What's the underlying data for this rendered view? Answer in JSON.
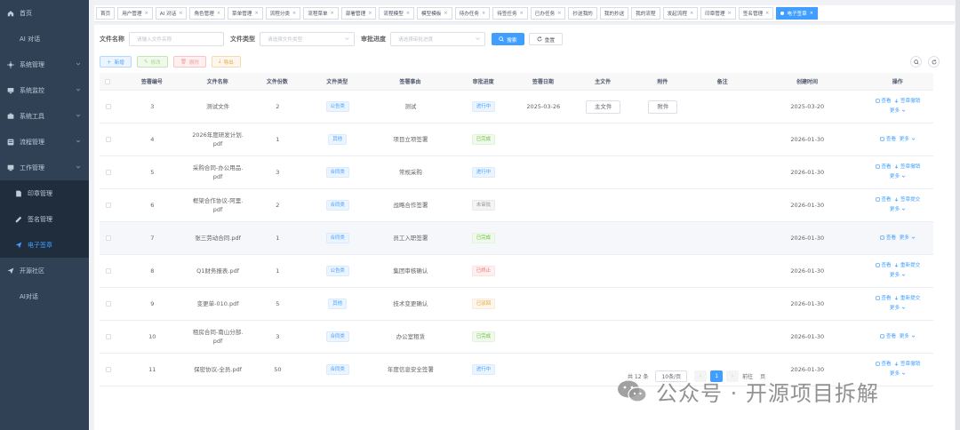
{
  "sidebar": {
    "items": [
      {
        "label": "首页",
        "icon": "home-icon",
        "type": "top"
      },
      {
        "label": "AI 对话",
        "type": "plain"
      },
      {
        "label": "系统管理",
        "icon": "gear-icon",
        "type": "group"
      },
      {
        "label": "系统监控",
        "icon": "monitor-icon",
        "type": "group"
      },
      {
        "label": "系统工具",
        "icon": "tool-icon",
        "type": "group"
      },
      {
        "label": "流程管理",
        "icon": "flow-icon",
        "type": "group"
      },
      {
        "label": "工作管理",
        "icon": "work-icon",
        "type": "group-open"
      }
    ],
    "submenu": [
      {
        "label": "印章管理",
        "icon": "document-icon"
      },
      {
        "label": "签名管理",
        "icon": "signature-icon"
      },
      {
        "label": "电子签章",
        "icon": "send-icon",
        "active": true
      }
    ],
    "bottom": [
      {
        "label": "开源社区",
        "icon": "send-icon",
        "type": "top"
      },
      {
        "label": "AI对话",
        "type": "plain"
      }
    ]
  },
  "tags": [
    {
      "label": "首页",
      "closable": false
    },
    {
      "label": "用户管理",
      "closable": true
    },
    {
      "label": "AI 对话",
      "closable": true
    },
    {
      "label": "角色管理",
      "closable": true
    },
    {
      "label": "菜单管理",
      "closable": true
    },
    {
      "label": "流程分类",
      "closable": true
    },
    {
      "label": "流程菜单",
      "closable": true
    },
    {
      "label": "部署管理",
      "closable": true
    },
    {
      "label": "流程模型",
      "closable": true
    },
    {
      "label": "模型模板",
      "closable": true
    },
    {
      "label": "待办任务",
      "closable": true
    },
    {
      "label": "待签任务",
      "closable": true
    },
    {
      "label": "已办任务",
      "closable": true
    },
    {
      "label": "抄送我的",
      "closable": false
    },
    {
      "label": "我的抄送",
      "closable": false
    },
    {
      "label": "我的流程",
      "closable": false
    },
    {
      "label": "发起流程",
      "closable": true
    },
    {
      "label": "印章管理",
      "closable": true
    },
    {
      "label": "签名管理",
      "closable": true
    },
    {
      "label": "电子签章",
      "closable": true,
      "active": true
    }
  ],
  "search": {
    "file_name_label": "文件名称",
    "file_name_placeholder": "请输入文件名称",
    "file_type_label": "文件类型",
    "file_type_placeholder": "请选择文件类型",
    "progress_label": "审批进度",
    "progress_placeholder": "请选择审批进度",
    "search_button": "搜索",
    "reset_button": "重置"
  },
  "toolbar": {
    "add": "新增",
    "edit": "修改",
    "delete": "删除",
    "export": "导出"
  },
  "table": {
    "columns": [
      "签署编号",
      "文件名称",
      "文件份数",
      "文件类型",
      "签署事由",
      "审批进度",
      "签署日期",
      "主文件",
      "附件",
      "备注",
      "创建时间",
      "操作"
    ],
    "rows": [
      {
        "id": "3",
        "name": "测试文件",
        "copies": "2",
        "type": "公告类",
        "type_color": "blue",
        "reason": "测试",
        "status": "进行中",
        "status_color": "blue",
        "sign_date": "2025-03-26",
        "main_file": "主文件",
        "attachment": "附件",
        "created": "2025-03-20",
        "op1": "查看",
        "op2": "签章撤销",
        "more": "更多",
        "two_line": true
      },
      {
        "id": "4",
        "name": "2026年度研发计划.pdf",
        "copies": "1",
        "type": "其他",
        "type_color": "blue",
        "reason": "项目立项签署",
        "status": "已完成",
        "status_color": "green",
        "sign_date": "",
        "main_file": "",
        "attachment": "",
        "created": "2026-01-30",
        "op1": "查看",
        "op2": "",
        "more": "更多",
        "two_line": false
      },
      {
        "id": "5",
        "name": "采购合同-办公用品.pdf",
        "copies": "3",
        "type": "合同类",
        "type_color": "blue",
        "reason": "常规采购",
        "status": "进行中",
        "status_color": "blue",
        "sign_date": "",
        "main_file": "",
        "attachment": "",
        "created": "2026-01-30",
        "op1": "查看",
        "op2": "签章撤销",
        "more": "更多",
        "two_line": true
      },
      {
        "id": "6",
        "name": "框架合作协议-阿里.pdf",
        "copies": "2",
        "type": "合同类",
        "type_color": "blue",
        "reason": "战略合作签署",
        "status": "未审批",
        "status_color": "gray",
        "sign_date": "",
        "main_file": "",
        "attachment": "",
        "created": "2026-01-30",
        "op1": "查看",
        "op2": "签章提交",
        "more": "更多",
        "two_line": true
      },
      {
        "id": "7",
        "name": "张三劳动合同.pdf",
        "copies": "1",
        "type": "合同类",
        "type_color": "blue",
        "reason": "员工入职签署",
        "status": "已完成",
        "status_color": "green",
        "sign_date": "",
        "main_file": "",
        "attachment": "",
        "created": "2026-01-30",
        "op1": "查看",
        "op2": "",
        "more": "更多",
        "two_line": false
      },
      {
        "id": "8",
        "name": "Q1财务报表.pdf",
        "copies": "1",
        "type": "公告类",
        "type_color": "blue",
        "reason": "集团审核确认",
        "status": "已终止",
        "status_color": "red",
        "sign_date": "",
        "main_file": "",
        "attachment": "",
        "created": "2026-01-30",
        "op1": "查看",
        "op2": "重新提交",
        "more": "更多",
        "two_line": true
      },
      {
        "id": "9",
        "name": "变更单-010.pdf",
        "copies": "5",
        "type": "其他",
        "type_color": "blue",
        "reason": "技术变更确认",
        "status": "已驳回",
        "status_color": "orange",
        "sign_date": "",
        "main_file": "",
        "attachment": "",
        "created": "2026-01-30",
        "op1": "查看",
        "op2": "重新提交",
        "more": "更多",
        "two_line": true
      },
      {
        "id": "10",
        "name": "租房合同-南山分部.pdf",
        "copies": "3",
        "type": "合同类",
        "type_color": "blue",
        "reason": "办公室租赁",
        "status": "已完成",
        "status_color": "green",
        "sign_date": "",
        "main_file": "",
        "attachment": "",
        "created": "2026-01-30",
        "op1": "查看",
        "op2": "",
        "more": "更多",
        "two_line": false
      },
      {
        "id": "11",
        "name": "保密协议-全员.pdf",
        "copies": "50",
        "type": "合同类",
        "type_color": "blue",
        "reason": "年度信息安全签署",
        "status": "进行中",
        "status_color": "blue",
        "sign_date": "",
        "main_file": "",
        "attachment": "",
        "created": "2026-01-30",
        "op1": "查看",
        "op2": "签章撤销",
        "more": "更多",
        "two_line": true
      }
    ]
  },
  "pagination": {
    "total": "共 12 条",
    "page_size": "10条/页",
    "current": "1",
    "goto": "前往",
    "page_suffix": "页"
  },
  "watermark": {
    "text": "公众号 · 开源项目拆解",
    "icon": "wechat-icon"
  }
}
